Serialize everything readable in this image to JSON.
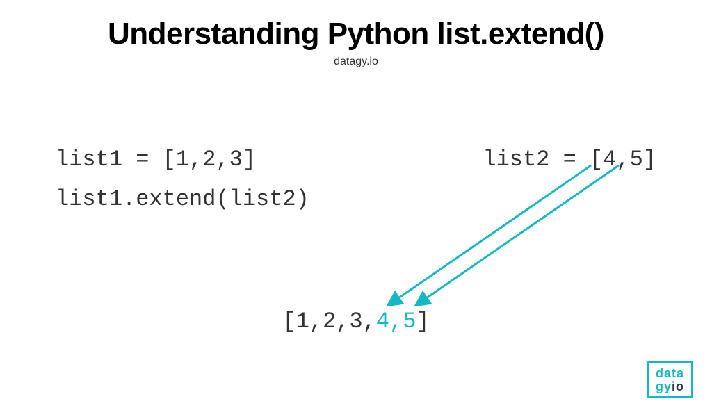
{
  "title": "Understanding Python list.extend()",
  "subtitle": "datagy.io",
  "code": {
    "list1_decl": "list1 = [1,2,3]",
    "list2_decl": "list2 = [4,5]",
    "extend_call": "list1.extend(list2)"
  },
  "result": {
    "prefix": "[1,2,3,",
    "highlight": "4,5",
    "suffix": "]"
  },
  "accent_color": "#14b8c4",
  "logo": {
    "line1": "data",
    "line2a": "gy",
    "line2b": "io"
  }
}
